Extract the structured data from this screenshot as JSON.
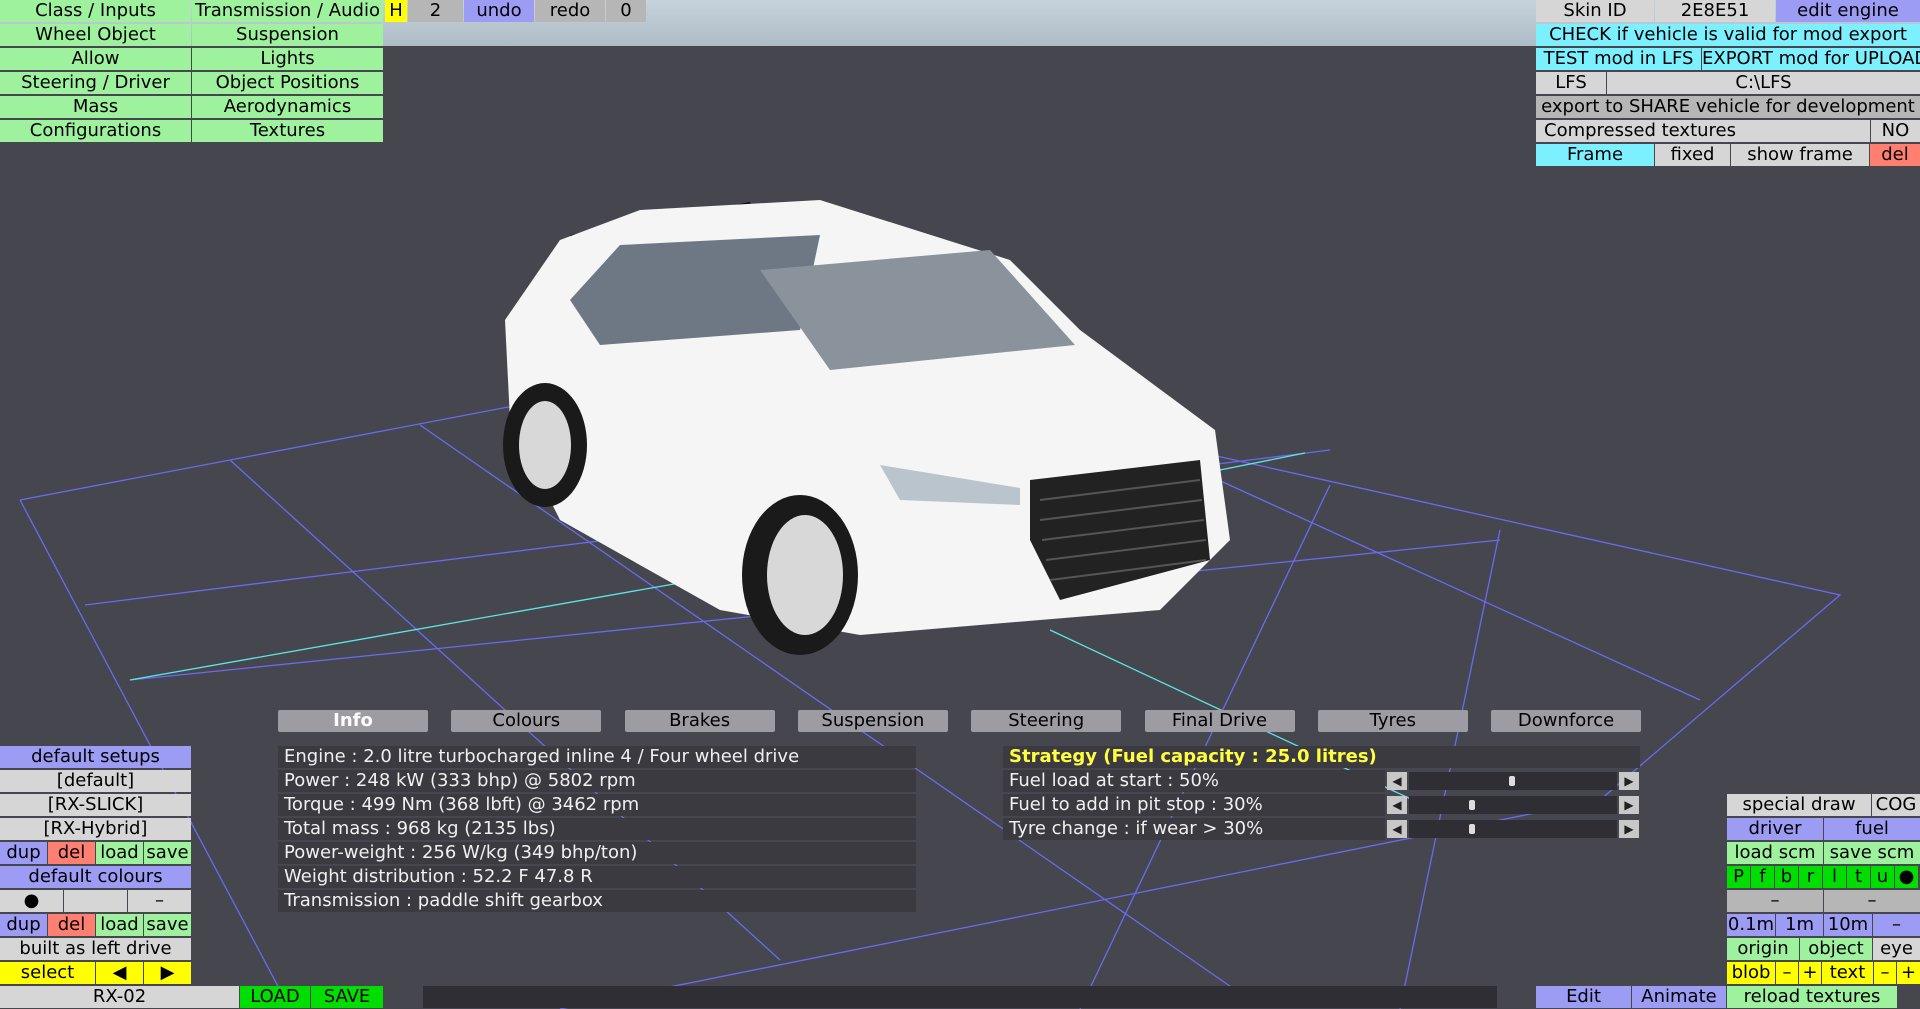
{
  "left_menu": [
    [
      "Class / Inputs",
      "Transmission / Audio"
    ],
    [
      "Wheel Object",
      "Suspension"
    ],
    [
      "Allow",
      "Lights"
    ],
    [
      "Steering / Driver",
      "Object Positions"
    ],
    [
      "Mass",
      "Aerodynamics"
    ],
    [
      "Configurations",
      "Textures"
    ]
  ],
  "top_bar": {
    "h": "H",
    "num": "2",
    "undo": "undo",
    "redo": "redo",
    "zero": "0"
  },
  "right_panel": {
    "skin_id_label": "Skin ID",
    "skin_id_value": "2E8E51",
    "edit_engine": "edit engine",
    "check": "CHECK if vehicle is valid for mod export",
    "test": "TEST mod in LFS",
    "export": "EXPORT mod for UPLOAD",
    "lfs": "LFS",
    "path": "C:\\LFS",
    "share": "export to SHARE vehicle for development",
    "compressed": "Compressed textures",
    "compressed_value": "NO",
    "frame": "Frame",
    "fixed": "fixed",
    "show_frame": "show frame",
    "del": "del"
  },
  "tabs": [
    "Info",
    "Colours",
    "Brakes",
    "Suspension",
    "Steering",
    "Final Drive",
    "Tyres",
    "Downforce"
  ],
  "info": [
    "Engine : 2.0 litre turbocharged inline 4 / Four wheel drive",
    "Power : 248 kW (333 bhp) @ 5802 rpm",
    "Torque : 499 Nm (368 lbft) @ 3462 rpm",
    "Total mass : 968 kg (2135 lbs)",
    "Power-weight : 256 W/kg (349 bhp/ton)",
    "Weight distribution : 52.2 F  47.8 R",
    "Transmission : paddle shift gearbox"
  ],
  "strategy": {
    "title": "Strategy (Fuel capacity : 25.0 litres)",
    "rows": [
      {
        "label": "Fuel load at start : 50%",
        "value": 0.5
      },
      {
        "label": "Fuel to add in pit stop : 30%",
        "value": 0.3
      },
      {
        "label": "Tyre change : if wear > 30%",
        "value": 0.3
      }
    ]
  },
  "left_bottom": {
    "default_setups": "default setups",
    "default": "[default]",
    "slick": "[RX-SLICK]",
    "hybrid": "[RX-Hybrid]",
    "dup": "dup",
    "del": "del",
    "load": "load",
    "save": "save",
    "default_colours": "default colours",
    "dot": "●",
    "dash": "–",
    "left_drive": "built as left drive",
    "select": "select",
    "prev": "◀",
    "next": "▶",
    "car": "RX-02",
    "load_btn": "LOAD",
    "save_btn": "SAVE"
  },
  "right_bottom": {
    "special_draw": "special draw",
    "cog": "COG",
    "driver": "driver",
    "fuel": "fuel",
    "load_scm": "load scm",
    "save_scm": "save scm",
    "letters": [
      "P",
      "f",
      "b",
      "r",
      "l",
      "t",
      "u",
      "●"
    ],
    "dash": "–",
    "m01": "0.1m",
    "m1": "1m",
    "m10": "10m",
    "origin": "origin",
    "object": "object",
    "eye": "eye",
    "blob": "blob",
    "minus": "–",
    "plus": "+",
    "text": "text",
    "edit": "Edit",
    "animate": "Animate",
    "reload": "reload textures"
  }
}
